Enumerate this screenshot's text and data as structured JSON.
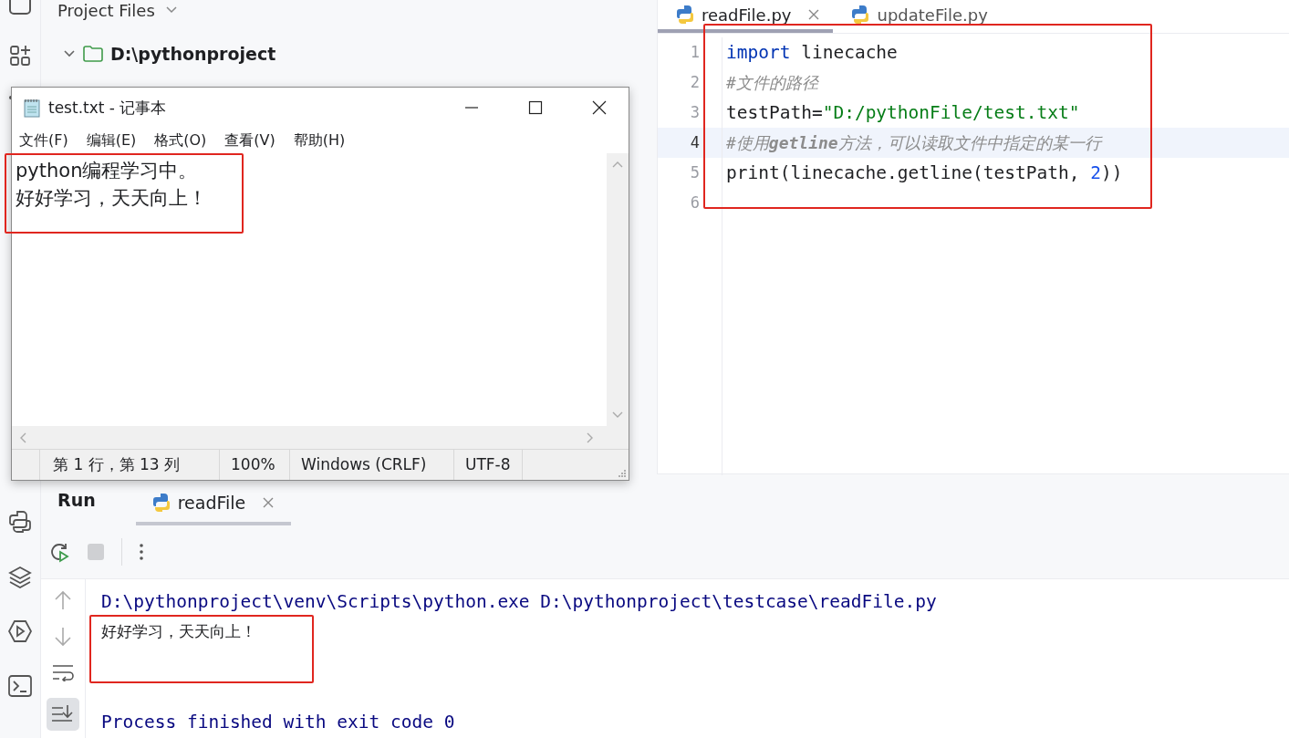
{
  "project": {
    "title": "Project Files",
    "tree": [
      {
        "label": "D:\\pythonproject",
        "expanded": true
      }
    ]
  },
  "editor": {
    "tabs": [
      {
        "label": "readFile.py",
        "selected": true
      },
      {
        "label": "updateFile.py",
        "selected": false
      }
    ],
    "annotated": true,
    "lines": [
      {
        "number": "1",
        "current": false,
        "tokens": [
          {
            "kind": "keyword",
            "text": "import"
          },
          {
            "kind": "plain",
            "text": " linecache"
          }
        ]
      },
      {
        "number": "2",
        "current": false,
        "tokens": [
          {
            "kind": "comment",
            "text": "#文件的路径"
          }
        ]
      },
      {
        "number": "3",
        "current": false,
        "tokens": [
          {
            "kind": "plain",
            "text": "testPath="
          },
          {
            "kind": "string",
            "text": "\"D:/pythonFile/test.txt\""
          }
        ]
      },
      {
        "number": "4",
        "current": true,
        "tokens": [
          {
            "kind": "comment",
            "text": "#使用**getline**方法，可以读取文件中指定的某一行"
          }
        ]
      },
      {
        "number": "5",
        "current": false,
        "tokens": [
          {
            "kind": "plain",
            "text": "print(linecache.getline(testPath, "
          },
          {
            "kind": "number",
            "text": "2"
          },
          {
            "kind": "plain",
            "text": "))"
          }
        ]
      },
      {
        "number": "6",
        "current": false
      }
    ]
  },
  "run": {
    "title": "Run",
    "tabs": [
      {
        "label": "readFile",
        "selected": true
      }
    ],
    "console": [
      {
        "kind": "command",
        "text": "D:\\pythonproject\\venv\\Scripts\\python.exe D:\\pythonproject\\testcase\\readFile.py"
      },
      {
        "kind": "output",
        "text": "好好学习，天天向上！",
        "annotated": true
      },
      {
        "kind": "blank"
      },
      {
        "kind": "blank"
      },
      {
        "kind": "exit",
        "text": "Process finished with exit code 0"
      }
    ]
  },
  "notepad": {
    "title": "test.txt - 记事本",
    "menu": [
      "文件(F)",
      "编辑(E)",
      "格式(O)",
      "查看(V)",
      "帮助(H)"
    ],
    "text": [
      "python编程学习中。",
      "好好学习，天天向上！"
    ],
    "annotated": true,
    "status": [
      "第 1 行，第 13 列",
      "100%",
      "Windows (CRLF)",
      "UTF-8"
    ]
  }
}
